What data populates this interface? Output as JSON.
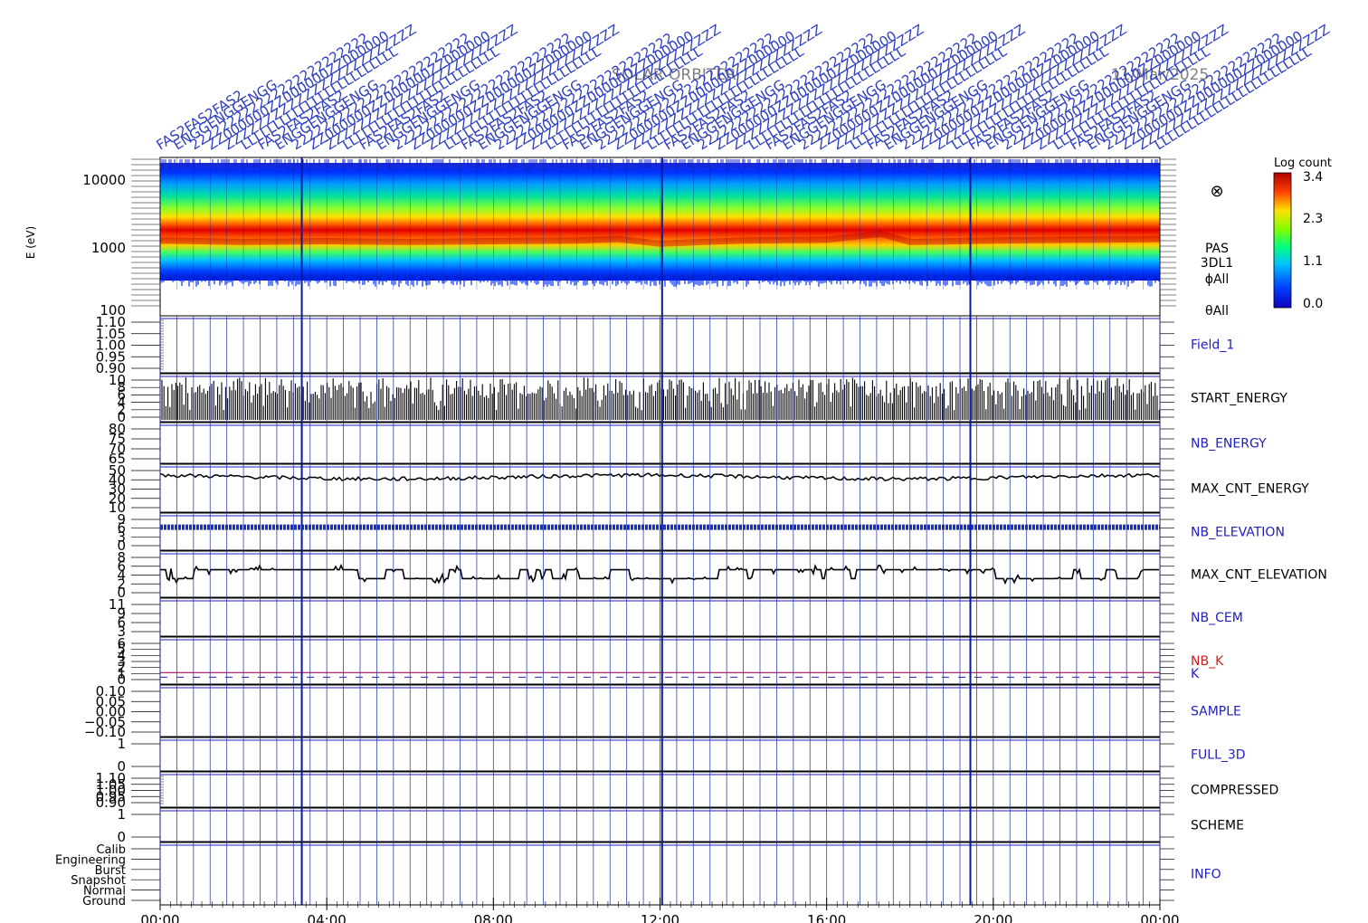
{
  "header": {
    "title": "SOLAR ORBITER",
    "date": "11/Mar/2025",
    "annotation_words": [
      "FAS2",
      "ENGG",
      "22222222",
      "ZZ000000",
      "ZZZZZZZZ",
      "LLLLLLLL"
    ]
  },
  "colorbar": {
    "label": "Log count",
    "ticks": [
      "3.4",
      "2.3",
      "1.1",
      "0.0"
    ]
  },
  "spectrogram": {
    "ylabel": "E (eV)",
    "yticks": [
      "10000",
      "1000",
      "100"
    ],
    "info_lines": [
      "PAS",
      "3DL1",
      "ϕAll",
      "θAll"
    ],
    "symbol": "⊗"
  },
  "panels": [
    {
      "name": "Field_1",
      "color": "#2020c0",
      "ticks": [
        "1.10",
        "1.05",
        "1.00",
        "0.95",
        "0.90"
      ]
    },
    {
      "name": "START_ENERGY",
      "color": "#000000",
      "ticks": [
        "10",
        "8",
        "6",
        "4",
        "2",
        "0"
      ]
    },
    {
      "name": "NB_ENERGY",
      "color": "#2020c0",
      "ticks": [
        "80",
        "75",
        "70",
        "65"
      ]
    },
    {
      "name": "MAX_CNT_ENERGY",
      "color": "#000000",
      "ticks": [
        "50",
        "40",
        "30",
        "20",
        "10"
      ]
    },
    {
      "name": "NB_ELEVATION",
      "color": "#2020c0",
      "ticks": [
        "9",
        "6",
        "3",
        "0"
      ]
    },
    {
      "name": "MAX_CNT_ELEVATION",
      "color": "#000000",
      "ticks": [
        "8",
        "6",
        "4",
        "2",
        "0"
      ]
    },
    {
      "name": "NB_CEM",
      "color": "#2020c0",
      "ticks": [
        "11",
        "9",
        "6",
        "3"
      ]
    },
    {
      "name": "NB_K",
      "color": "#d02020",
      "ticks": [
        "6",
        "5",
        "4",
        "3",
        "2",
        "1",
        "0"
      ],
      "secondary_name": "K",
      "secondary_color": "#2020c0"
    },
    {
      "name": "SAMPLE",
      "color": "#2020c0",
      "ticks": [
        "0.10",
        "0.05",
        "0.00",
        "−0.05",
        "−0.10"
      ]
    },
    {
      "name": "FULL_3D",
      "color": "#2020c0",
      "ticks": [
        "1",
        "0"
      ]
    },
    {
      "name": "COMPRESSED",
      "color": "#000000",
      "ticks": [
        "1.10",
        "1.05",
        "1.00",
        "0.95",
        "0.90"
      ]
    },
    {
      "name": "SCHEME",
      "color": "#000000",
      "ticks": [
        "1",
        "0"
      ]
    },
    {
      "name": "INFO",
      "color": "#2020c0",
      "ticks": [
        "Calib",
        "Engineering",
        "Burst",
        "Snapshot",
        "Normal",
        "Ground"
      ]
    }
  ],
  "chart_data": {
    "type": "heatmap",
    "title": "SOLAR ORBITER",
    "subtitle": "11/Mar/2025",
    "xlabel": "",
    "ylabel": "E (eV)",
    "x_ticks": [
      "00:00",
      "04:00",
      "08:00",
      "12:00",
      "16:00",
      "20:00",
      "00:00"
    ],
    "xlim_hours": [
      0,
      24
    ],
    "ylim_eV": [
      100,
      20000
    ],
    "y_scale": "log",
    "color_scale": {
      "label": "Log count",
      "min": 0.0,
      "max": 3.4,
      "ticks": [
        3.4,
        2.3,
        1.1,
        0.0
      ]
    },
    "peak_energy_eV_by_hour": [
      [
        0,
        1600
      ],
      [
        2,
        1500
      ],
      [
        4,
        1550
      ],
      [
        6,
        1500
      ],
      [
        8,
        1550
      ],
      [
        10,
        1600
      ],
      [
        11,
        1700
      ],
      [
        12,
        1400
      ],
      [
        14,
        1600
      ],
      [
        16,
        1650
      ],
      [
        17.3,
        2100
      ],
      [
        18,
        1500
      ],
      [
        20,
        1600
      ],
      [
        22,
        1650
      ],
      [
        24,
        1700
      ]
    ],
    "max_cnt_energy_level": 42,
    "max_cnt_elevation_levels": [
      3,
      5
    ],
    "nb_elevation_level": 6,
    "nb_k_level": 1,
    "grid": true
  }
}
